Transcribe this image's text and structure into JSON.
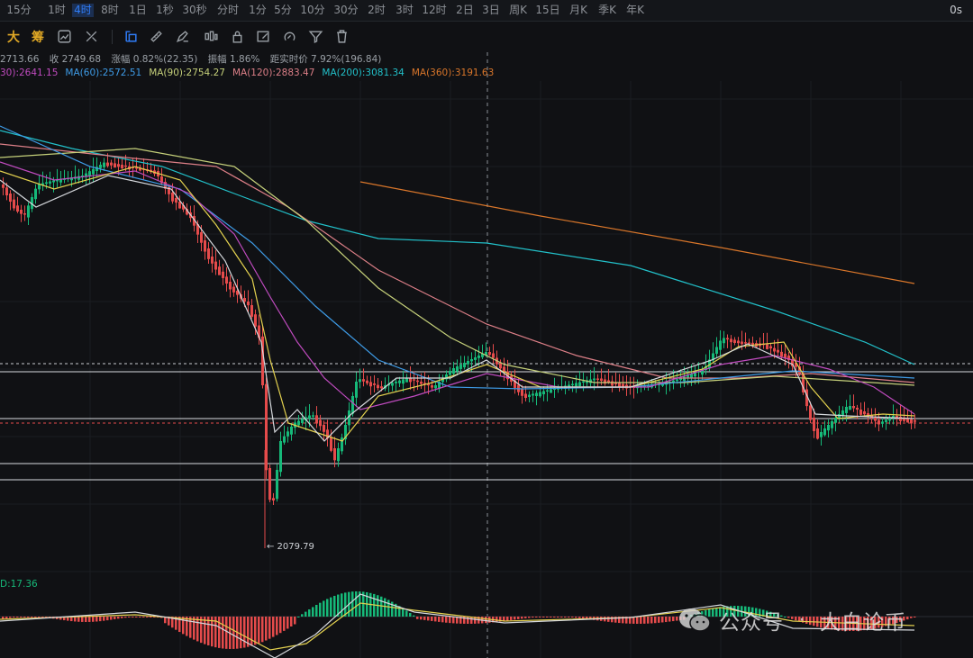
{
  "timeframes": [
    "15分",
    "1时",
    "4时",
    "8时",
    "1日",
    "1秒",
    "30秒",
    "分时",
    "1分",
    "5分",
    "10分",
    "30分",
    "2时",
    "3时",
    "12时",
    "2日",
    "3日",
    "周K",
    "15日",
    "月K",
    "季K",
    "年K"
  ],
  "active_timeframe": "4时",
  "countdown": "0s",
  "toolbar": {
    "label_big": "大",
    "label_chip": "筹",
    "icons": [
      "indicator-icon",
      "draw-tools-icon",
      "trend-line-icon",
      "ruler-icon",
      "brush-icon",
      "candle-style-icon",
      "lock-icon",
      "edit-icon",
      "magnet-icon",
      "filter-icon",
      "trash-icon"
    ]
  },
  "info": {
    "open": "2713.66",
    "close_label": "收 2749.68",
    "change_label": "涨幅 0.82%(22.35)",
    "amplitude_label": "振幅 1.86%",
    "distance_label": "距实时价 7.92%(196.84)"
  },
  "ma_legend": [
    {
      "label": "30):2641.15",
      "color": "#c04bbf"
    },
    {
      "label": "MA(60):2572.51",
      "color": "#3e9be6"
    },
    {
      "label": "MA(90):2754.27",
      "color": "#c5d07a"
    },
    {
      "label": "MA(120):2883.47",
      "color": "#dc7f87"
    },
    {
      "label": "MA(200):3081.34",
      "color": "#22c0c9"
    },
    {
      "label": "MA(360):3191.63",
      "color": "#d9762a"
    }
  ],
  "low_marker": "← 2079.79",
  "macd_label": "D:17.36",
  "watermark": {
    "left": "公众号",
    "sep": "·",
    "right": "大白论币"
  },
  "colors": {
    "up": "#16b979",
    "down": "#e54b4b",
    "accent": "#2f7cf6",
    "brand": "#e0a825"
  }
}
